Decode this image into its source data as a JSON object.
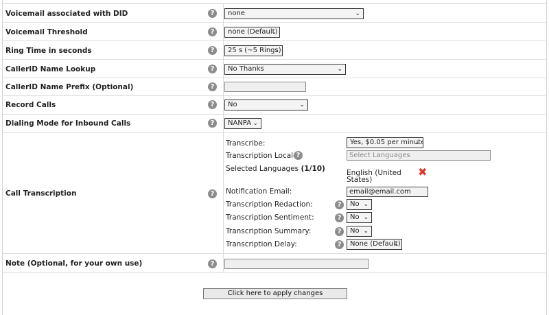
{
  "rows": {
    "voicemail_did": {
      "label": "Voicemail associated with DID",
      "value": "none"
    },
    "voicemail_threshold": {
      "label": "Voicemail Threshold",
      "value": "none (Default)"
    },
    "ring_time": {
      "label": "Ring Time in seconds",
      "value": "25 s (~5 Rings)"
    },
    "callerid_lookup": {
      "label": "CallerID Name Lookup",
      "value": "No Thanks"
    },
    "callerid_prefix": {
      "label": "CallerID Name Prefix (Optional)",
      "value": ""
    },
    "record_calls": {
      "label": "Record Calls",
      "value": "No"
    },
    "dialing_mode": {
      "label": "Dialing Mode for Inbound Calls",
      "value": "NANPA"
    },
    "call_transcription": {
      "label": "Call Transcription"
    },
    "note": {
      "label": "Note (Optional, for your own use)",
      "value": ""
    }
  },
  "transcription": {
    "transcribe_label": "Transcribe:",
    "transcribe_value": "Yes, $0.05 per minute",
    "locale_label": "Transcription Locale:",
    "locale_placeholder": "Select Languages",
    "selected_label": "Selected Languages",
    "selected_count": "(1/10)",
    "selected_language_line1": "English (United",
    "selected_language_line2": "States)",
    "email_label": "Notification Email:",
    "email_value": "email@email.com",
    "redaction_label": "Transcription Redaction:",
    "redaction_value": "No",
    "sentiment_label": "Transcription Sentiment:",
    "sentiment_value": "No",
    "summary_label": "Transcription Summary:",
    "summary_value": "No",
    "delay_label": "Transcription Delay:",
    "delay_value": "None (Default)"
  },
  "apply_button": "Click here to apply changes",
  "icons": {
    "help": "help-icon",
    "remove": "remove-icon",
    "chevron": "chevron-down-icon"
  },
  "colors": {
    "remove_icon": "#d9382d",
    "help_icon": "#8c8c8c"
  }
}
